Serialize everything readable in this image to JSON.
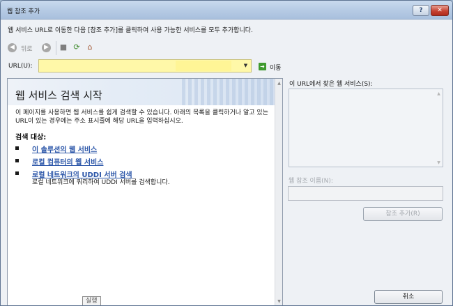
{
  "window": {
    "title": "웹 참조 추가",
    "help_label": "?",
    "close_label": "✕"
  },
  "instruction": "웹 서비스 URL로 이동한 다음 [참조 추가]를 클릭하여 사용 가능한 서비스를 모두 추가합니다.",
  "toolbar": {
    "back_label": "뒤로",
    "icons": [
      "back-icon",
      "forward-icon",
      "stop-icon",
      "refresh-icon",
      "home-icon"
    ]
  },
  "url": {
    "label": "URL(U):",
    "value": "",
    "go_label": "이동"
  },
  "browser": {
    "banner_title": "웹 서비스 검색 시작",
    "intro": "이 페이지를 사용하면 웹 서비스를 쉽게 검색할 수 있습니다. 아래의 목록을 클릭하거나 알고 있는 URL이 있는 경우에는 주소 표시줄에 해당 URL을 입력하십시오.",
    "search_target_label": "검색 대상:",
    "links": [
      "이 솔루션의 웹 서비스",
      "로컬 컴퓨터의 웹 서비스",
      "로컬 네트워크의 UDDI 서버 검색"
    ],
    "uddi_desc": "로컬 네트워크에 쿼리하여 UDDI 서버를 검색합니다.",
    "tooltip": "실행"
  },
  "side_panel": {
    "found_label": "이 URL에서 찾은 웹 서비스(S):",
    "refname_label": "웹 참조 이름(N):",
    "refname_value": "",
    "add_ref_label": "참조 추가(R)",
    "cancel_label": "취소"
  },
  "colors": {
    "url_highlight": "#fff8a8",
    "link": "#2a55a8",
    "title_bar": "#b5cae4",
    "close_button": "#c64333"
  }
}
